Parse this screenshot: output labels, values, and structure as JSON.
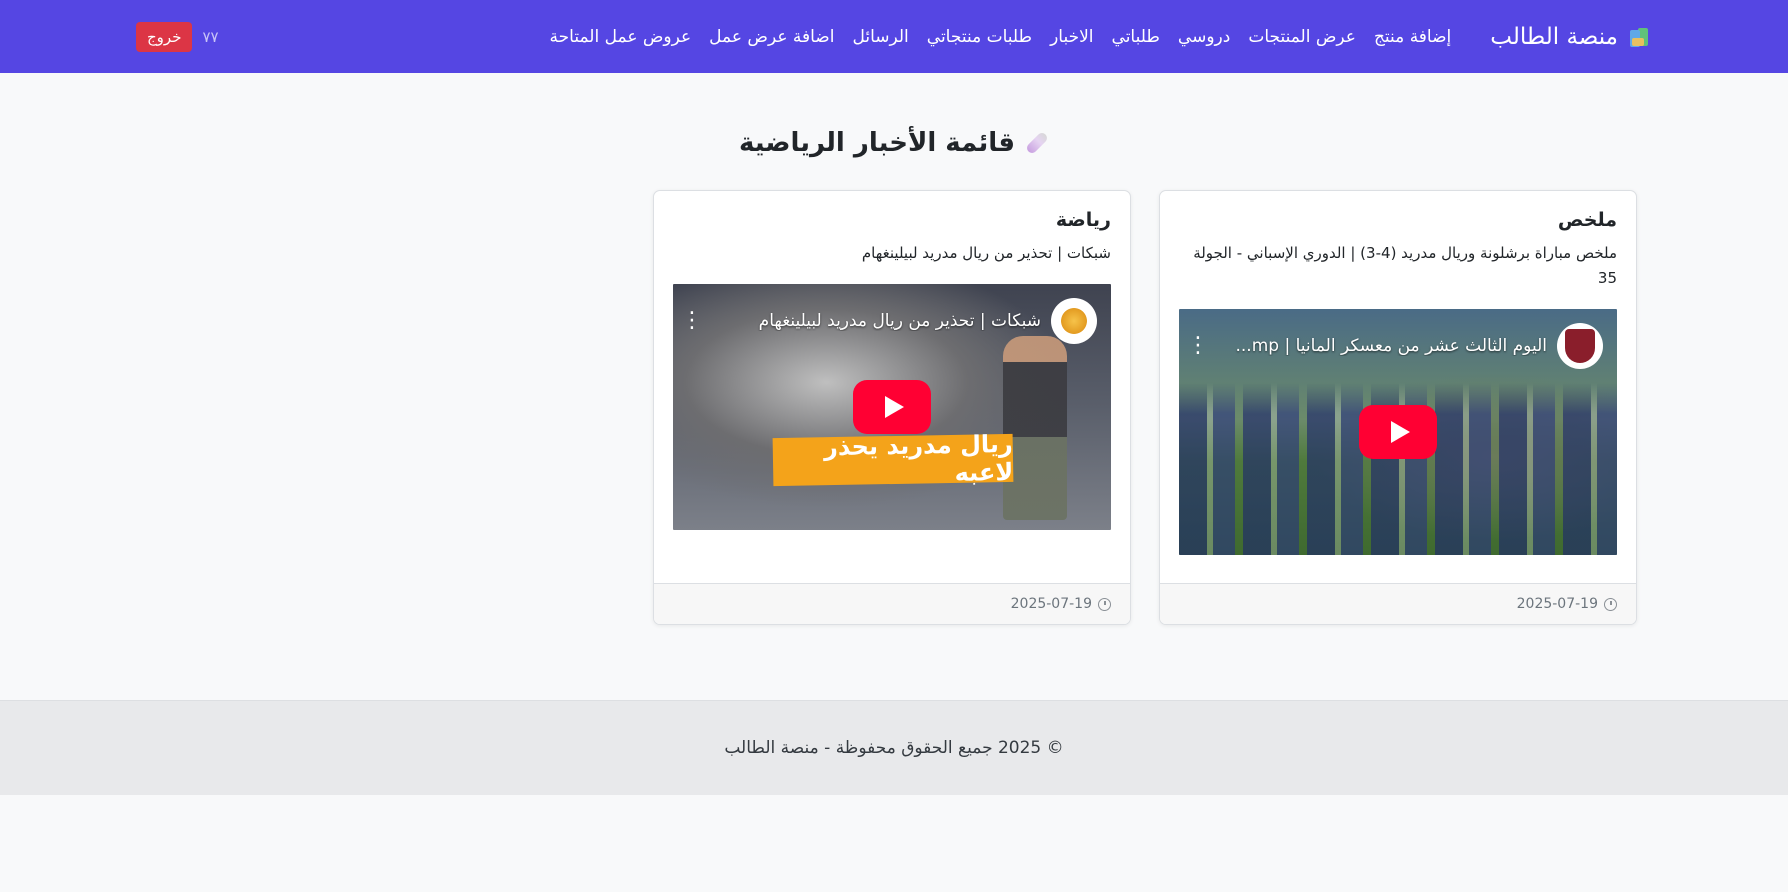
{
  "navbar": {
    "brand": "منصة الطالب",
    "brand_icon": "books-icon",
    "background": "#5546e3",
    "links": [
      "إضافة منتج",
      "عرض المنتجات",
      "دروسي",
      "طلباتي",
      "الاخبار",
      "طلبات منتجاتي",
      "الرسائل",
      "اضافة عرض عمل",
      "عروض عمل المتاحة"
    ],
    "user": "٧٧",
    "logout": "خروج"
  },
  "page": {
    "title": "قائمة الأخبار الرياضية",
    "title_icon": "syringe-icon"
  },
  "news": [
    {
      "category": "ملخص",
      "headline": "ملخص مباراة برشلونة وريال مدريد (4-3) | الدوري الإسباني - الجولة 35",
      "video_title": "اليوم الثالث عشر من معسكر المانيا | mp...",
      "date": "2025-07-19"
    },
    {
      "category": "رياضة",
      "headline": "شبكات | تحذير من ريال مدريد لبيلينغهام",
      "video_title": "شبكات | تحذير من ريال مدريد لبيلينغهام",
      "banner": "ريال مدريد يحذر لاعبه",
      "date": "2025-07-19"
    }
  ],
  "footer": {
    "text": "© 2025 جميع الحقوق محفوظة - منصة الطالب"
  }
}
